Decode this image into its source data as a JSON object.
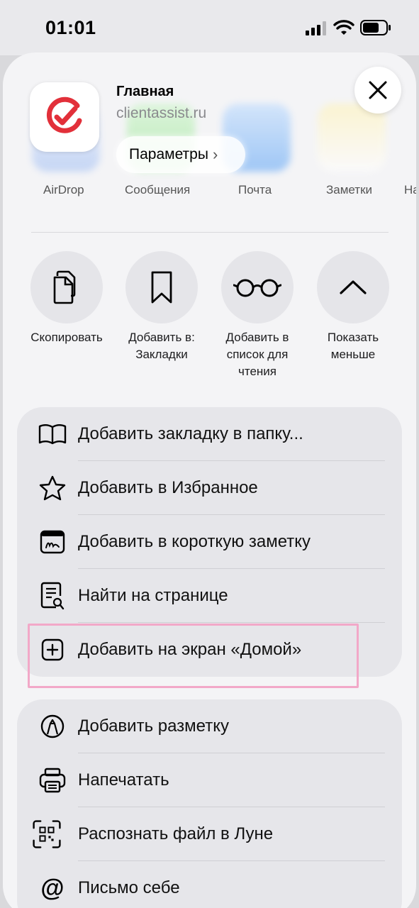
{
  "status": {
    "time": "01:01"
  },
  "share_targets": [
    "AirDrop",
    "Сообщения",
    "Почта",
    "Заметки",
    "На"
  ],
  "header": {
    "title": "Главная",
    "url": "clientassist.ru",
    "params_label": "Параметры"
  },
  "actions": [
    {
      "label": "Скопировать"
    },
    {
      "label": "Добавить в: Закладки"
    },
    {
      "label": "Добавить в список для чтения"
    },
    {
      "label": "Показать меньше"
    }
  ],
  "menu1": [
    {
      "label": "Добавить закладку в папку..."
    },
    {
      "label": "Добавить в Избранное"
    },
    {
      "label": "Добавить в короткую заметку"
    },
    {
      "label": "Найти на странице"
    },
    {
      "label": "Добавить на экран «Домой»"
    }
  ],
  "menu2": [
    {
      "label": "Добавить разметку"
    },
    {
      "label": "Напечатать"
    },
    {
      "label": "Распознать файл в Луне"
    },
    {
      "label": "Письмо себе"
    }
  ],
  "colors": {
    "brand": "#e2303a",
    "highlight": "#f2a8c8"
  }
}
